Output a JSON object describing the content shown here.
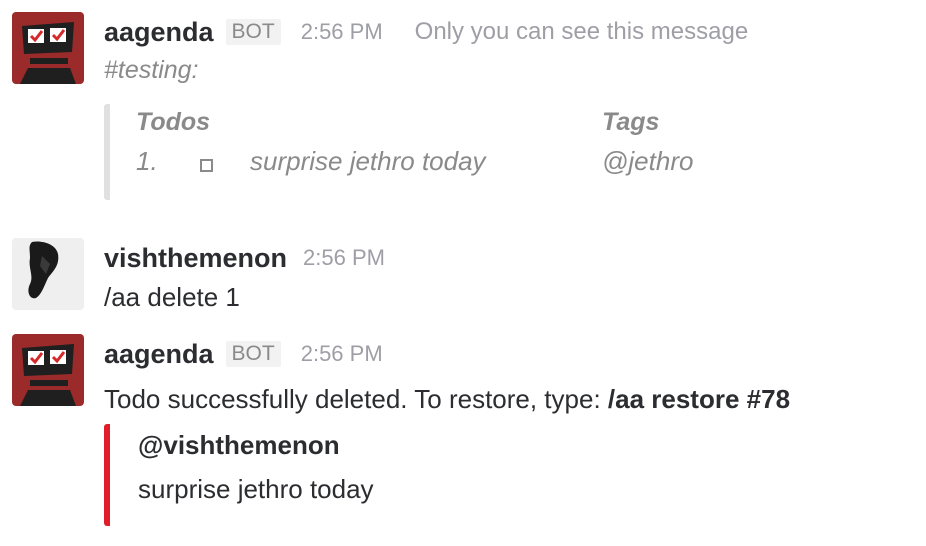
{
  "messages": [
    {
      "sender": "aagenda",
      "badge": "BOT",
      "time": "2:56 PM",
      "ephemeral_note": "Only you can see this message",
      "channel": "#testing:",
      "todo_table": {
        "todos_header": "Todos",
        "tags_header": "Tags",
        "row": {
          "number": "1.",
          "text": "surprise jethro today",
          "tag": "@jethro"
        }
      }
    },
    {
      "sender": "vishthemenon",
      "time": "2:56 PM",
      "text": "/aa delete 1"
    },
    {
      "sender": "aagenda",
      "badge": "BOT",
      "time": "2:56 PM",
      "text": "Todo successfully deleted. To restore, type: ",
      "command": "/aa restore #78",
      "attachment": {
        "title": "@vishthemenon",
        "body": "surprise jethro today",
        "color": "#e01e2a"
      }
    }
  ]
}
